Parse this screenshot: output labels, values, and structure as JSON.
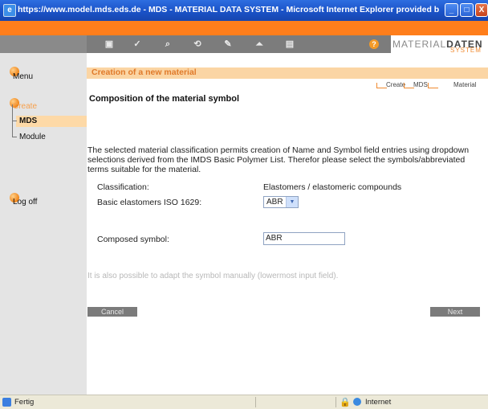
{
  "window": {
    "title": "https://www.model.mds.eds.de - MDS - MATERIAL DATA SYSTEM - Microsoft Internet Explorer provided by EDS COE",
    "min_label": "_",
    "max_label": "□",
    "close_label": "X"
  },
  "logo": {
    "part1_light": "MATERIAL",
    "part1_bold": "DATEN",
    "part2": "SYSTEM"
  },
  "nav_icons": [
    "home-icon",
    "check-icon",
    "search-icon",
    "refresh-icon",
    "edit-icon",
    "upload-icon",
    "print-icon",
    "help-icon"
  ],
  "nav_glyphs": [
    "▣",
    "✓",
    "⌕",
    "⟲",
    "✎",
    "⏶",
    "▤",
    "?"
  ],
  "sidebar": {
    "menu": "Menu",
    "create": "Create",
    "mds": "MDS",
    "module": "Module",
    "logoff": "Log off"
  },
  "header": {
    "title": "Creation of a new material"
  },
  "breadcrumb": [
    "Create",
    "MDS",
    "Material"
  ],
  "section_title": "Composition of the material symbol",
  "description": "The selected material classification permits creation of Name and Symbol field entries using dropdown selections derived from the IMDS Basic Polymer List. Therefor please select the symbols/abbreviated terms suitable for the material.",
  "form": {
    "classification_label": "Classification:",
    "classification_value": "Elastomers / elastomeric compounds",
    "basic_label": "Basic elastomers ISO 1629:",
    "basic_value": "ABR",
    "composed_label": "Composed symbol:",
    "composed_value": "ABR"
  },
  "hint": "It is also possible to adapt the symbol manually (lowermost input field).",
  "buttons": {
    "cancel": "Cancel",
    "next": "Next"
  },
  "status": {
    "text": "Fertig",
    "zone": "Internet"
  }
}
